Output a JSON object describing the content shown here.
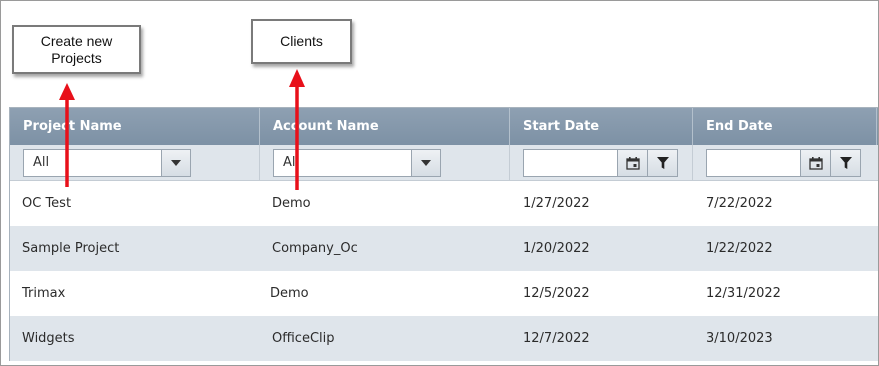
{
  "callouts": {
    "create_projects": "Create new\nProjects",
    "clients": "Clients"
  },
  "grid": {
    "columns": [
      "Project Name",
      "Account Name",
      "Start Date",
      "End Date"
    ],
    "filters": {
      "project_name": "All",
      "account_name": "All"
    },
    "rows": [
      {
        "project": "OC Test",
        "account": "Demo",
        "start": "1/27/2022",
        "end": "7/22/2022"
      },
      {
        "project": "Sample Project",
        "account": "Company_Oc",
        "start": "1/20/2022",
        "end": "1/22/2022"
      },
      {
        "project": "Trimax",
        "account": "Demo",
        "start": "12/5/2022",
        "end": "12/31/2022"
      },
      {
        "project": "Widgets",
        "account": "OfficeClip",
        "start": "12/7/2022",
        "end": "3/10/2023"
      }
    ]
  },
  "icons": {
    "dropdown": "chevron-down-icon",
    "calendar": "calendar-icon",
    "filter": "filter-icon"
  },
  "colors": {
    "header": "#8799ac",
    "alt_row": "#dfe5eb",
    "arrow": "#e8101a"
  }
}
